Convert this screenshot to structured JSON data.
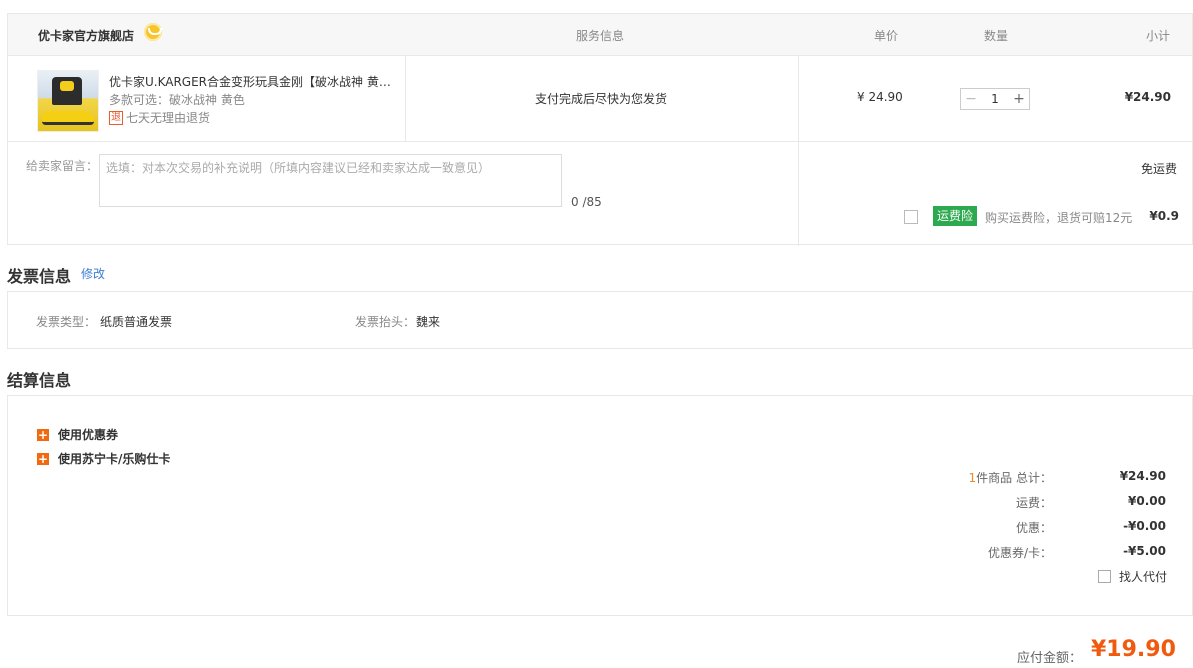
{
  "order": {
    "store_name": "优卡家官方旗舰店",
    "col_service": "服务信息",
    "col_unit_price": "单价",
    "col_quantity": "数量",
    "col_subtotal": "小计",
    "item": {
      "title": "优卡家U.KARGER合金变形玩具金刚【破冰战神 黄色】",
      "variant": "多款可选：破冰战神 黄色",
      "return_icon": "退",
      "return_policy": "七天无理由退货",
      "service": "支付完成后尽快为您发货",
      "unit_price": "¥ 24.90",
      "qty_minus": "−",
      "quantity": "1",
      "qty_plus": "+",
      "subtotal": "¥24.90"
    },
    "message_label": "给卖家留言：",
    "message_placeholder": "选填：对本次交易的补充说明（所填内容建议已经和卖家达成一致意见）",
    "message_count": "0 /85",
    "shipping": "免运费",
    "insurance_badge": "运费险",
    "insurance_desc": "购买运费险，退货可赔12元",
    "insurance_price": "¥0.9"
  },
  "invoice": {
    "title": "发票信息",
    "edit": "修改",
    "type_label": "发票类型：",
    "type_value": "纸质普通发票",
    "head_label": "发票抬头：",
    "head_value": "魏来"
  },
  "settlement": {
    "title": "结算信息",
    "use_coupon": "使用优惠券",
    "use_card": "使用苏宁卡/乐购仕卡",
    "count_num": "1",
    "count_text": "件商品  总计：",
    "total": "¥24.90",
    "freight_label": "运费：",
    "freight": "¥0.00",
    "discount_label": "优惠：",
    "discount": "-¥0.00",
    "coupon_label": "优惠券/卡：",
    "coupon": "-¥5.00",
    "proxy_pay": "找人代付",
    "pay_label": "应付金额：",
    "pay_amount": "¥19.90"
  },
  "colors": {
    "accent_orange": "#f05a0f",
    "insurance_green": "#2daa4f",
    "link_blue": "#3b7dd8"
  },
  "icons": {
    "store_badge": "store-badge-icon",
    "plus": "plus-square-icon"
  }
}
